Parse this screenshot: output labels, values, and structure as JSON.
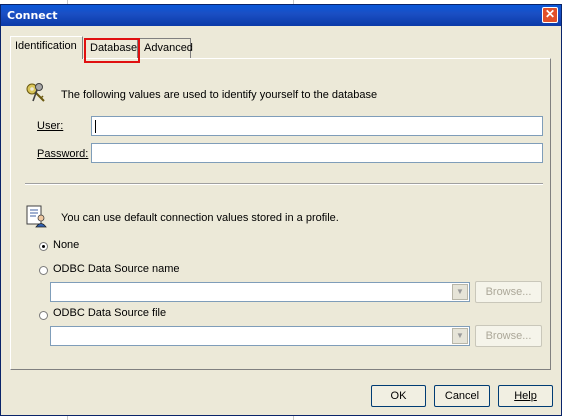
{
  "window": {
    "title": "Connect",
    "close_icon": "close-icon"
  },
  "tabs": [
    {
      "label": "Identification",
      "active": true
    },
    {
      "label": "Database",
      "active": false,
      "highlighted": true
    },
    {
      "label": "Advanced",
      "active": false
    }
  ],
  "identification": {
    "intro_text": "The following values are used to identify yourself to the database",
    "user_label": "User:",
    "user_value": "",
    "password_label": "Password:",
    "password_value": ""
  },
  "profile": {
    "intro_text": "You can use default connection values stored in a profile.",
    "options": [
      {
        "label": "None",
        "selected": true
      },
      {
        "label": "ODBC Data Source name",
        "selected": false
      },
      {
        "label": "ODBC Data Source file",
        "selected": false
      }
    ],
    "browse_label": "Browse...",
    "dsn_value": "",
    "file_value": ""
  },
  "buttons": {
    "ok": "OK",
    "cancel": "Cancel",
    "help": "Help"
  },
  "colors": {
    "title_bar": "#1b4fc4",
    "dialog_bg": "#ece9d8",
    "highlight": "#e01010"
  }
}
